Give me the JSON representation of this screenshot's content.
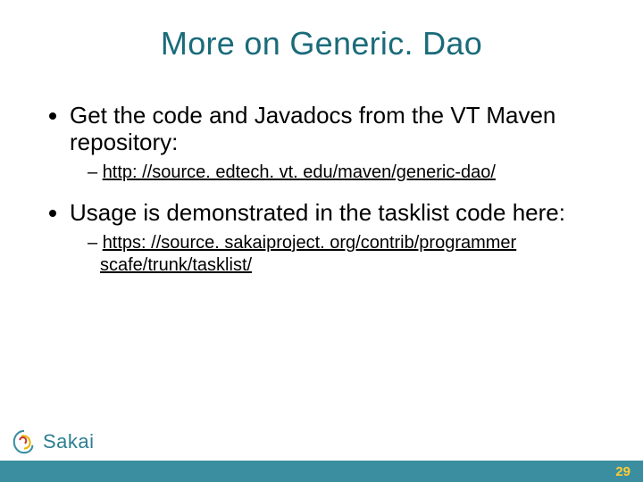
{
  "title": "More on Generic. Dao",
  "bullets": {
    "b1": "Get the code and Javadocs from the VT Maven repository:",
    "b1_link": "http: //source. edtech. vt. edu/maven/generic-dao/",
    "b2": "Usage is demonstrated in the tasklist code here:",
    "b2_link_a": "https: //source. sakaiproject. org/contrib/programmer",
    "b2_link_b": "scafe/trunk/tasklist/"
  },
  "brand": {
    "name": "Sakai"
  },
  "page": "29"
}
